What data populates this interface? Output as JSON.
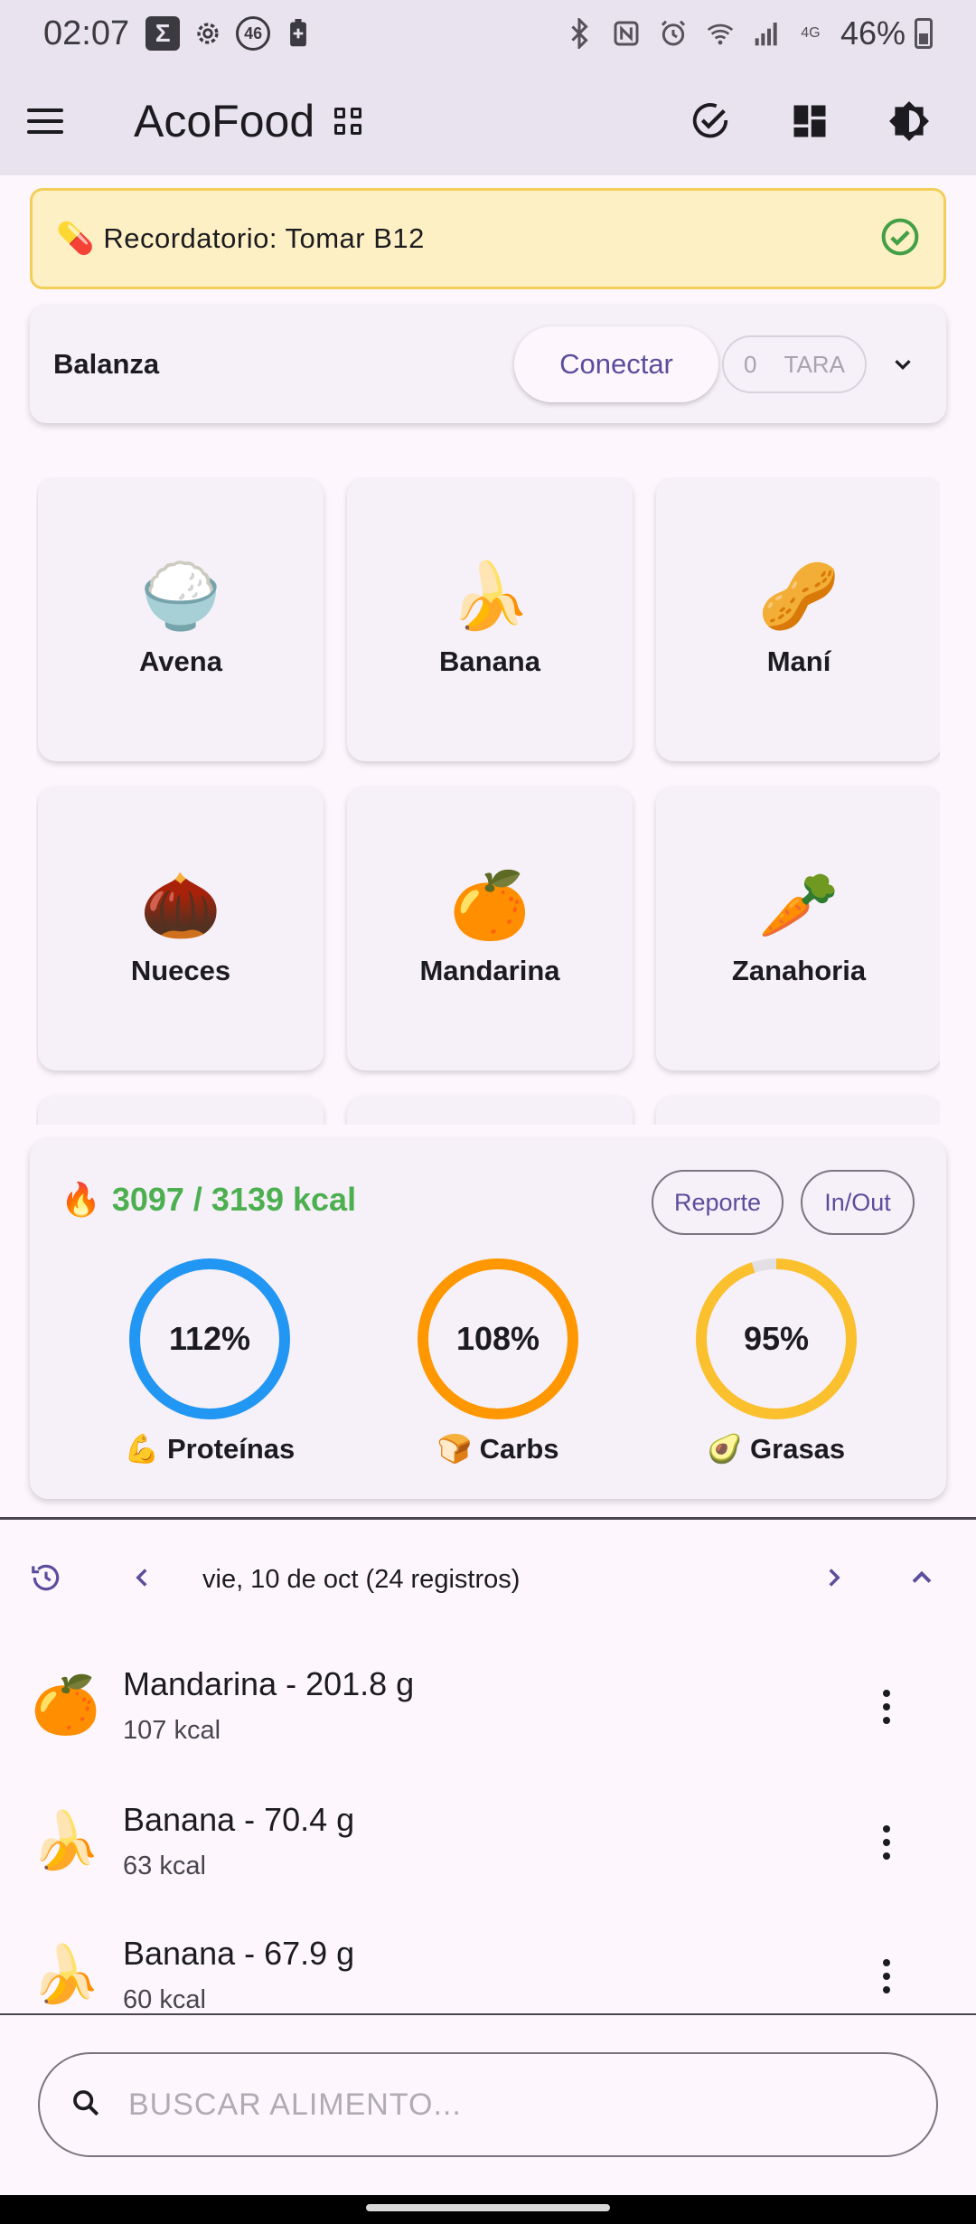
{
  "status_bar": {
    "time": "02:07",
    "sigma": "Σ",
    "net_badge": "46",
    "battery": "46%",
    "lte": "4G"
  },
  "app_bar": {
    "title": "AcoFood"
  },
  "reminder": {
    "text": "Recordatorio: Tomar B12",
    "icon": "💊"
  },
  "scale": {
    "label": "Balanza",
    "connect_label": "Conectar",
    "weight": "0",
    "tara_label": "TARA"
  },
  "foods": [
    {
      "emoji": "🍚",
      "name": "Avena"
    },
    {
      "emoji": "🍌",
      "name": "Banana"
    },
    {
      "emoji": "🥜",
      "name": "Maní"
    },
    {
      "emoji": "🌰",
      "name": "Nueces"
    },
    {
      "emoji": "🍊",
      "name": "Mandarina"
    },
    {
      "emoji": "🥕",
      "name": "Zanahoria"
    }
  ],
  "summary": {
    "kcal_text": "3097 / 3139 kcal",
    "kcal_icon": "🔥",
    "report_label": "Reporte",
    "inout_label": "In/Out",
    "macros": [
      {
        "percent_label": "112%",
        "percent": 112,
        "label": "💪 Proteínas",
        "color": "#2196f3"
      },
      {
        "percent_label": "108%",
        "percent": 108,
        "label": "🍞 Carbs",
        "color": "#ff9800"
      },
      {
        "percent_label": "95%",
        "percent": 95,
        "label": "🥑 Grasas",
        "color": "#fbc02d"
      }
    ]
  },
  "date_nav": {
    "text": "vie, 10 de oct (24 registros)"
  },
  "log": [
    {
      "emoji": "🍊",
      "title": "Mandarina - 201.8 g",
      "sub": "107 kcal"
    },
    {
      "emoji": "🍌",
      "title": "Banana - 70.4 g",
      "sub": "63 kcal"
    },
    {
      "emoji": "🍌",
      "title": "Banana - 67.9 g",
      "sub": "60 kcal"
    }
  ],
  "search": {
    "placeholder": "BUSCAR ALIMENTO..."
  },
  "colors": {
    "accent": "#5b4d9c",
    "kcal_green": "#4caf50",
    "reminder_bg": "#fdf0c4",
    "check_green": "#43a047"
  }
}
